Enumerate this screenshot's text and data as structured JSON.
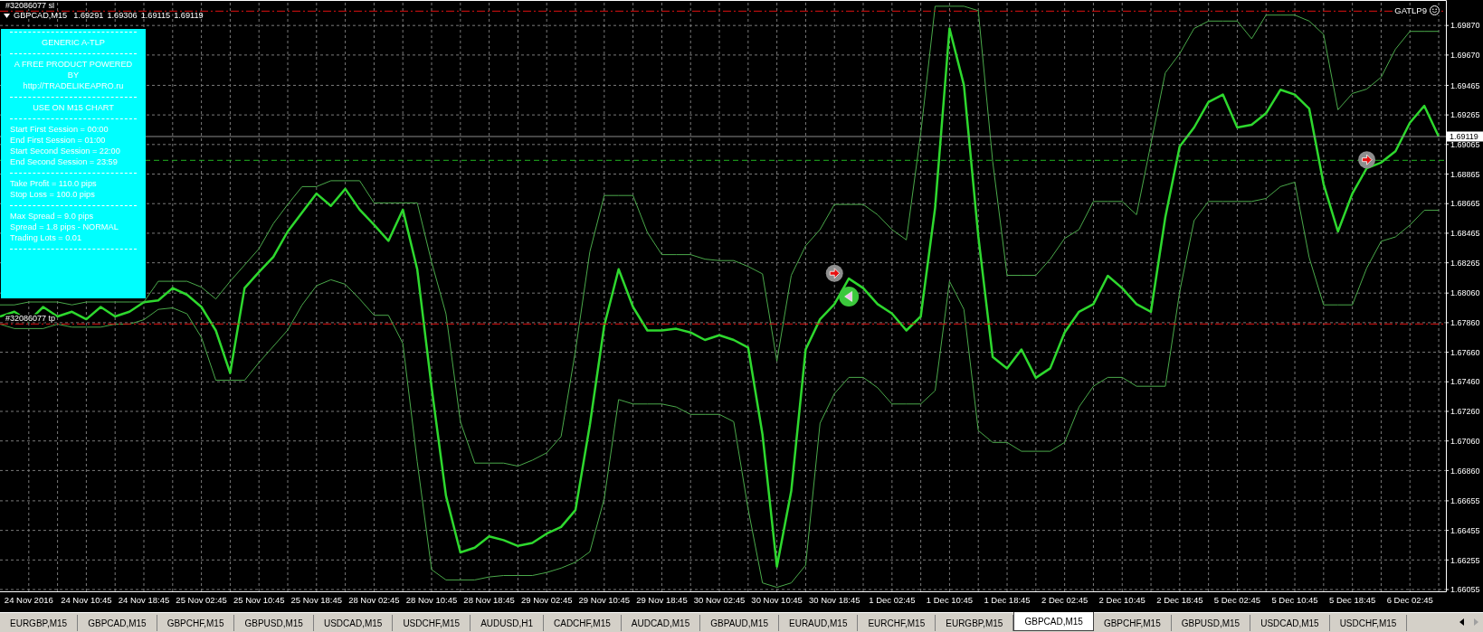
{
  "chart": {
    "header": {
      "quotes": [
        "1.69291",
        "1.69306",
        "1.69115",
        "1.69119"
      ]
    },
    "expert": {
      "name": "GATLP9",
      "enabled": true
    },
    "info_panel": {
      "sections": [
        {
          "kind": "heading",
          "lines": [
            "GENERIC A-TLP"
          ]
        },
        {
          "kind": "heading",
          "lines": [
            "A FREE PRODUCT POWERED",
            "BY",
            "http://TRADELIKEAPRO.ru"
          ]
        },
        {
          "kind": "heading",
          "lines": [
            "USE ON M15 CHART"
          ]
        },
        {
          "kind": "settings",
          "lines": [
            "Start First Session = 00:00",
            "End First Session = 01:00",
            "Start Second Session = 22:00",
            "End Second Session = 23:59"
          ]
        },
        {
          "kind": "settings",
          "lines": [
            "Take Profit = 110.0 pips",
            "Stop Loss = 100.0 pips"
          ]
        },
        {
          "kind": "settings",
          "lines": [
            "Max Spread = 9.0 pips",
            "Spread = 1.8 pips - NORMAL",
            "Trading Lots = 0.01"
          ]
        }
      ]
    },
    "last_price": "1.69119",
    "chart_data": {
      "type": "line",
      "grid": true,
      "categories": [
        null,
        null,
        "24 Nov 2016",
        null,
        null,
        null,
        "24 Nov 10:45",
        null,
        null,
        null,
        "24 Nov 18:45",
        null,
        null,
        null,
        "25 Nov 02:45",
        null,
        null,
        null,
        "25 Nov 10:45",
        null,
        null,
        null,
        "25 Nov 18:45",
        null,
        null,
        null,
        "28 Nov 02:45",
        null,
        null,
        null,
        "28 Nov 10:45",
        null,
        null,
        null,
        "28 Nov 18:45",
        null,
        null,
        null,
        "29 Nov 02:45",
        null,
        null,
        null,
        "29 Nov 10:45",
        null,
        null,
        null,
        "29 Nov 18:45",
        null,
        null,
        null,
        "30 Nov 02:45",
        null,
        null,
        null,
        "30 Nov 10:45",
        null,
        null,
        null,
        "30 Nov 18:45",
        null,
        null,
        null,
        "1 Dec 02:45",
        null,
        null,
        null,
        "1 Dec 10:45",
        null,
        null,
        null,
        "1 Dec 18:45",
        null,
        null,
        null,
        "2 Dec 02:45",
        null,
        null,
        null,
        "2 Dec 10:45",
        null,
        null,
        null,
        "2 Dec 18:45",
        null,
        null,
        null,
        "5 Dec 02:45",
        null,
        null,
        null,
        "5 Dec 10:45",
        null,
        null,
        null,
        "5 Dec 18:45",
        null,
        null,
        null,
        "6 Dec 02:45",
        null,
        null
      ],
      "series": [
        {
          "name": "GBPCAD,M15",
          "color": "#2ed82e",
          "values": [
            1.67902,
            1.67934,
            1.6787,
            1.67966,
            1.67902,
            1.67934,
            1.67883,
            1.67966,
            1.67902,
            1.67934,
            1.67998,
            1.68011,
            1.68094,
            1.68049,
            1.67966,
            1.67807,
            1.67519,
            1.68094,
            1.68203,
            1.68305,
            1.68477,
            1.68605,
            1.68733,
            1.6865,
            1.68765,
            1.68624,
            1.68522,
            1.68413,
            1.68624,
            1.68222,
            1.67423,
            1.66689,
            1.66306,
            1.66338,
            1.66414,
            1.66389,
            1.6635,
            1.6637,
            1.66433,
            1.66478,
            1.66593,
            1.67168,
            1.67839,
            1.68222,
            1.67966,
            1.67807,
            1.67807,
            1.67819,
            1.67794,
            1.67743,
            1.67775,
            1.67743,
            1.67692,
            1.67104,
            1.6621,
            1.66721,
            1.67679,
            1.67883,
            1.67985,
            1.68158,
            1.68094,
            1.67985,
            1.67922,
            1.67807,
            1.67902,
            1.68637,
            1.6985,
            1.69467,
            1.68445,
            1.67628,
            1.67551,
            1.67679,
            1.67487,
            1.67551,
            1.67794,
            1.67934,
            1.67985,
            1.68177,
            1.68094,
            1.67985,
            1.67934,
            1.68573,
            1.69052,
            1.6918,
            1.69352,
            1.69403,
            1.6918,
            1.69199,
            1.69276,
            1.69435,
            1.69403,
            1.69308,
            1.68797,
            1.68477,
            1.68733,
            1.68905,
            1.68943,
            1.6902,
            1.69212,
            1.69327,
            1.69119
          ]
        },
        {
          "color": "#4aa84a",
          "values": [
            1.6798,
            1.6798,
            1.68,
            1.68,
            1.68,
            1.6798,
            1.68,
            1.68,
            1.68,
            1.68,
            1.68,
            1.6814,
            1.6814,
            1.6814,
            1.681,
            1.6802,
            1.6814,
            1.6825,
            1.6836,
            1.6853,
            1.6866,
            1.6878,
            1.6878,
            1.6882,
            1.6882,
            1.6882,
            1.6867,
            1.6867,
            1.6867,
            1.6867,
            1.6827,
            1.6792,
            1.6719,
            1.6691,
            1.6691,
            1.6691,
            1.6689,
            1.6693,
            1.6698,
            1.6709,
            1.6767,
            1.6834,
            1.6872,
            1.6872,
            1.6872,
            1.6847,
            1.6832,
            1.6832,
            1.6832,
            1.6829,
            1.6828,
            1.6828,
            1.6824,
            1.6819,
            1.676,
            1.6818,
            1.6838,
            1.6849,
            1.6866,
            1.6866,
            1.6866,
            1.6859,
            1.6849,
            1.6842,
            1.6914,
            1.7,
            1.7,
            1.7,
            1.6997,
            1.6895,
            1.6818,
            1.6818,
            1.6818,
            1.6829,
            1.6843,
            1.6849,
            1.6868,
            1.6868,
            1.6868,
            1.6859,
            1.6907,
            1.6955,
            1.6968,
            1.6985,
            1.699,
            1.699,
            1.699,
            1.6978,
            1.6994,
            1.6994,
            1.6994,
            1.699,
            1.6981,
            1.693,
            1.6941,
            1.6944,
            1.6952,
            1.6971,
            1.6983,
            1.6983,
            1.6983
          ]
        },
        {
          "color": "#4aa84a",
          "values": [
            1.6785,
            1.6782,
            1.6782,
            1.6782,
            1.6785,
            1.6783,
            1.6783,
            1.6783,
            1.6785,
            1.6785,
            1.6788,
            1.6795,
            1.6796,
            1.6792,
            1.6776,
            1.6747,
            1.6747,
            1.6747,
            1.6759,
            1.677,
            1.6781,
            1.6798,
            1.6811,
            1.6815,
            1.6812,
            1.6802,
            1.6791,
            1.6791,
            1.6772,
            1.6692,
            1.6619,
            1.6612,
            1.6612,
            1.6612,
            1.6614,
            1.6615,
            1.6615,
            1.6615,
            1.6617,
            1.662,
            1.6624,
            1.6631,
            1.6667,
            1.6734,
            1.6731,
            1.6731,
            1.6731,
            1.6729,
            1.6724,
            1.6724,
            1.6724,
            1.6719,
            1.666,
            1.661,
            1.6607,
            1.661,
            1.6622,
            1.6718,
            1.6738,
            1.6749,
            1.6749,
            1.6742,
            1.6731,
            1.6731,
            1.6731,
            1.674,
            1.6814,
            1.6795,
            1.6713,
            1.6705,
            1.6705,
            1.6699,
            1.6699,
            1.6699,
            1.6705,
            1.6729,
            1.6743,
            1.6749,
            1.6749,
            1.6743,
            1.6743,
            1.6743,
            1.6807,
            1.6855,
            1.6868,
            1.6868,
            1.6868,
            1.6868,
            1.687,
            1.6878,
            1.6881,
            1.683,
            1.6798,
            1.6798,
            1.6798,
            1.6823,
            1.6841,
            1.6844,
            1.6852,
            1.6862,
            1.6862
          ]
        },
        {
          "color": "#8e8e8e",
          "marker": "circle",
          "values": [
            null,
            null,
            null,
            null,
            null,
            null,
            null,
            null,
            null,
            null,
            null,
            null,
            null,
            null,
            null,
            null,
            null,
            null,
            null,
            null,
            null,
            null,
            null,
            null,
            null,
            null,
            null,
            null,
            null,
            null,
            null,
            null,
            null,
            null,
            null,
            null,
            null,
            null,
            null,
            null,
            null,
            null,
            null,
            null,
            null,
            null,
            null,
            null,
            null,
            null,
            null,
            null,
            null,
            null,
            null,
            null,
            null,
            null,
            1.68194,
            null,
            null,
            null,
            null,
            null,
            null,
            null,
            null,
            null,
            null,
            null,
            null,
            null,
            null,
            null,
            null,
            null,
            null,
            null,
            null,
            null,
            null,
            null,
            null,
            null,
            null,
            null,
            null,
            null,
            null,
            null,
            null,
            null,
            null,
            null,
            null,
            1.68962,
            null,
            null,
            null,
            null,
            null
          ]
        },
        {
          "color": "#3cc83c",
          "marker": "circle",
          "values": [
            null,
            null,
            null,
            null,
            null,
            null,
            null,
            null,
            null,
            null,
            null,
            null,
            null,
            null,
            null,
            null,
            null,
            null,
            null,
            null,
            null,
            null,
            null,
            null,
            null,
            null,
            null,
            null,
            null,
            null,
            null,
            null,
            null,
            null,
            null,
            null,
            null,
            null,
            null,
            null,
            null,
            null,
            null,
            null,
            null,
            null,
            null,
            null,
            null,
            null,
            null,
            null,
            null,
            null,
            null,
            null,
            null,
            null,
            null,
            1.68037,
            null,
            null,
            null,
            null,
            null,
            null,
            null,
            null,
            null,
            null,
            null,
            null,
            null,
            null,
            null,
            null,
            null,
            null,
            null,
            null,
            null,
            null,
            null,
            null,
            null,
            null,
            null,
            null,
            null,
            null,
            null,
            null,
            null,
            null,
            null,
            null,
            null,
            null,
            null,
            null,
            null
          ]
        }
      ],
      "ylim": [
        1.66043,
        1.70024
      ],
      "yticks": [
        {
          "value": 1.6987,
          "label": "1.69870"
        },
        {
          "value": 1.6967,
          "label": "1.69670"
        },
        {
          "value": 1.69465,
          "label": "1.69465"
        },
        {
          "value": 1.69265,
          "label": "1.69265"
        },
        {
          "value": 1.69065,
          "label": "1.69065"
        },
        {
          "value": 1.68865,
          "label": "1.68865"
        },
        {
          "value": 1.68665,
          "label": "1.68665"
        },
        {
          "value": 1.68465,
          "label": "1.68465"
        },
        {
          "value": 1.68265,
          "label": "1.68265"
        },
        {
          "value": 1.6806,
          "label": "1.68060"
        },
        {
          "value": 1.6786,
          "label": "1.67860"
        },
        {
          "value": 1.6766,
          "label": "1.67660"
        },
        {
          "value": 1.6746,
          "label": "1.67460"
        },
        {
          "value": 1.6726,
          "label": "1.67260"
        },
        {
          "value": 1.6706,
          "label": "1.67060"
        },
        {
          "value": 1.6686,
          "label": "1.66860"
        },
        {
          "value": 1.66655,
          "label": "1.66655"
        },
        {
          "value": 1.66455,
          "label": "1.66455"
        },
        {
          "value": 1.66255,
          "label": "1.66255"
        },
        {
          "value": 1.66055,
          "label": "1.66055"
        }
      ],
      "ref_lines": [
        {
          "axis": "y",
          "value": 1.69967,
          "color": "#e01010",
          "label": "#32086077 sl"
        },
        {
          "axis": "y",
          "value": 1.67851,
          "color": "#e01010",
          "label": "#32086077 tp"
        },
        {
          "axis": "y",
          "value": 1.68958,
          "color": "#20b020"
        },
        {
          "axis": "y",
          "value": 1.69119,
          "color": "#8c8c8c"
        }
      ]
    }
  },
  "tabs": [
    {
      "label": "EURGBP,M15",
      "selected": false
    },
    {
      "label": "GBPCAD,M15",
      "selected": false
    },
    {
      "label": "GBPCHF,M15",
      "selected": false
    },
    {
      "label": "GBPUSD,M15",
      "selected": false
    },
    {
      "label": "USDCAD,M15",
      "selected": false
    },
    {
      "label": "USDCHF,M15",
      "selected": false
    },
    {
      "label": "AUDUSD,H1",
      "selected": false
    },
    {
      "label": "CADCHF,M15",
      "selected": false
    },
    {
      "label": "AUDCAD,M15",
      "selected": false
    },
    {
      "label": "GBPAUD,M15",
      "selected": false
    },
    {
      "label": "EURAUD,M15",
      "selected": false
    },
    {
      "label": "EURCHF,M15",
      "selected": false
    },
    {
      "label": "EURGBP,M15",
      "selected": false
    },
    {
      "label": "GBPCAD,M15",
      "selected": true
    },
    {
      "label": "GBPCHF,M15",
      "selected": false
    },
    {
      "label": "GBPUSD,M15",
      "selected": false
    },
    {
      "label": "USDCAD,M15",
      "selected": false
    },
    {
      "label": "USDCHF,M15",
      "selected": false
    }
  ],
  "tab_scroll": [
    {
      "kind": "left",
      "disabled": false
    },
    {
      "kind": "right",
      "disabled": true
    }
  ]
}
